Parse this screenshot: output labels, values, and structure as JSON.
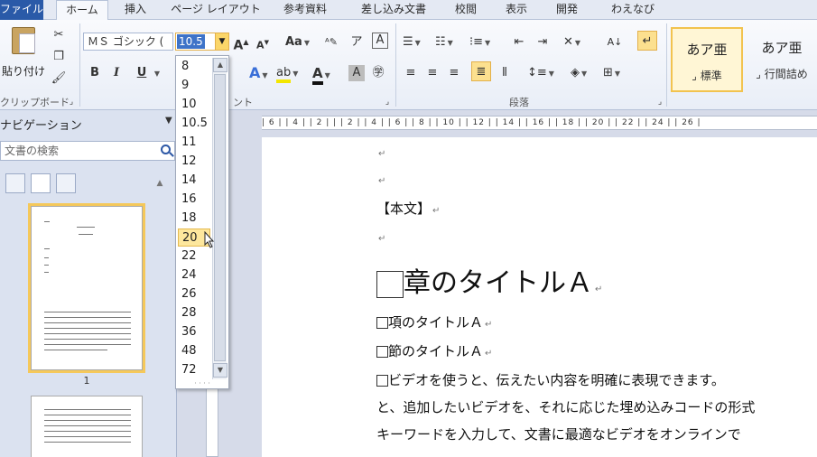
{
  "tabs": [
    {
      "label": "ファイル",
      "file": true
    },
    {
      "label": "ホーム",
      "active": true
    },
    {
      "label": "挿入"
    },
    {
      "label": "ページ レイアウト"
    },
    {
      "label": "参考資料"
    },
    {
      "label": "差し込み文書"
    },
    {
      "label": "校閲"
    },
    {
      "label": "表示"
    },
    {
      "label": "開発"
    },
    {
      "label": "わえなび"
    }
  ],
  "ribbon": {
    "paste_label": "貼り付け",
    "clipboard_group": "クリップボード",
    "font_group_tail": "ント",
    "paragraph_group": "段落",
    "font_name": "ＭＳ ゴシック (",
    "font_size": "10.5",
    "bold": "B",
    "italic": "I",
    "underline": "U",
    "styles": [
      {
        "sample": "あア亜",
        "name": "標準",
        "selected": true
      },
      {
        "sample": "あア亜",
        "name": "行間詰め"
      }
    ]
  },
  "font_size_dropdown": {
    "items": [
      "8",
      "9",
      "10",
      "10.5",
      "11",
      "12",
      "14",
      "16",
      "18",
      "20",
      "22",
      "24",
      "26",
      "28",
      "36",
      "48",
      "72"
    ],
    "hovered": "20"
  },
  "nav": {
    "title": "ナビゲーション",
    "search_placeholder": "文書の検索",
    "page_number": "1"
  },
  "ruler_text": "| 6 |  | 4 |  | 2 |  |  | 2 |  | 4 |  | 6 |  | 8 |  | 10 |  | 12 |  | 14 |  | 16 |  | 18 |  | 20 |  | 22 |  | 24 |  | 26 |",
  "document": {
    "body_label": "【本文】",
    "chapter_title": "章のタイトルＡ",
    "section_title": "項のタイトルＡ",
    "subsection_title": "節のタイトルＡ",
    "para1": "ビデオを使うと、伝えたい内容を明確に表現できます。",
    "para2": "と、追加したいビデオを、それに応じた埋め込みコードの形式",
    "para3": "キーワードを入力して、文書に最適なビデオをオンラインで"
  }
}
